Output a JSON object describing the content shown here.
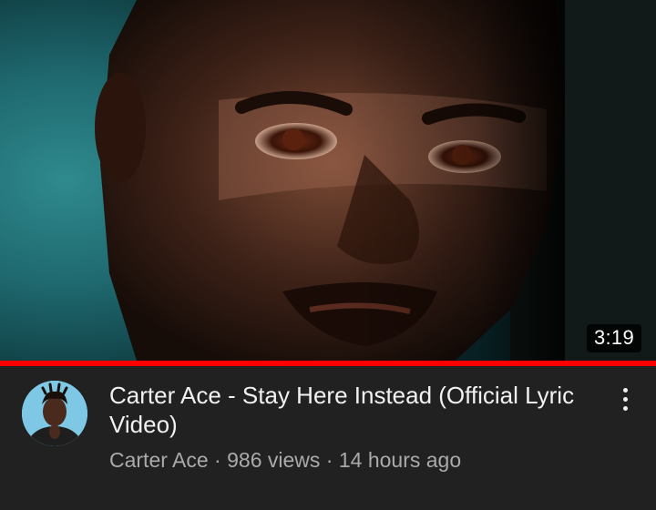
{
  "video": {
    "duration": "3:19",
    "progress_fraction": 1.0,
    "title": "Carter Ace - Stay Here Instead (Official Lyric Video)",
    "channel": "Carter Ace",
    "views": "986 views",
    "age": "14 hours ago",
    "separator": "·"
  },
  "icons": {
    "more": "more-vert-icon"
  },
  "colors": {
    "background": "#212121",
    "progress": "#ff0000",
    "title_text": "#f1f1f1",
    "meta_text": "#aaaaaa"
  }
}
